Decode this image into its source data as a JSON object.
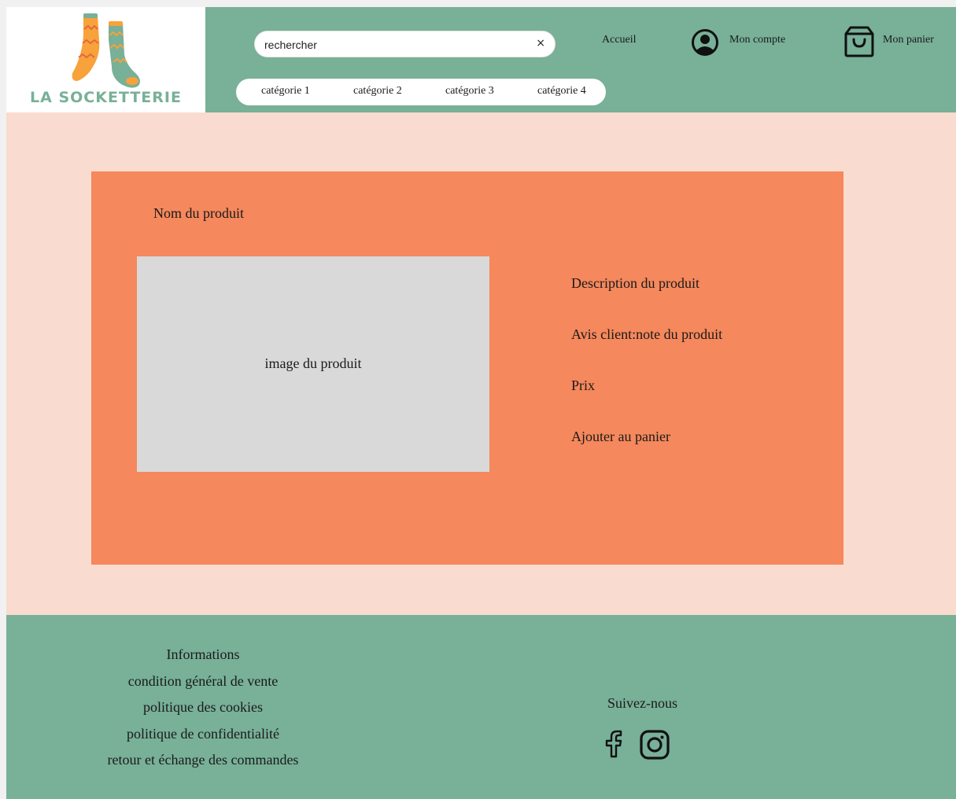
{
  "brand": {
    "name": "LA SOCKETTERIE"
  },
  "search": {
    "value": "rechercher",
    "clear_icon": "×"
  },
  "categories": [
    "catégorie 1",
    "catégorie 2",
    "catégorie 3",
    "catégorie 4"
  ],
  "nav": {
    "home": "Accueil",
    "account": "Mon compte",
    "cart": "Mon panier"
  },
  "product": {
    "name": "Nom du produit",
    "image_label": "image du produit",
    "description": "Description du produit",
    "review": "Avis client:note du produit",
    "price": "Prix",
    "add_to_cart": "Ajouter au panier"
  },
  "footer": {
    "title": "Informations",
    "links": [
      "condition général de vente",
      "politique des cookies",
      "politique de confidentialité",
      "retour et échange des commandes"
    ],
    "follow": "Suivez-nous"
  },
  "colors": {
    "header_bg": "#78b098",
    "page_bg": "#f9dccf",
    "panel_bg": "#f5885c",
    "image_placeholder": "#d9d9d9",
    "logo_green": "#78b098",
    "sock_orange": "#f7a23b"
  },
  "icons": {
    "account": "account-circle-icon",
    "cart": "shopping-bag-icon",
    "facebook": "facebook-icon",
    "instagram": "instagram-icon"
  }
}
